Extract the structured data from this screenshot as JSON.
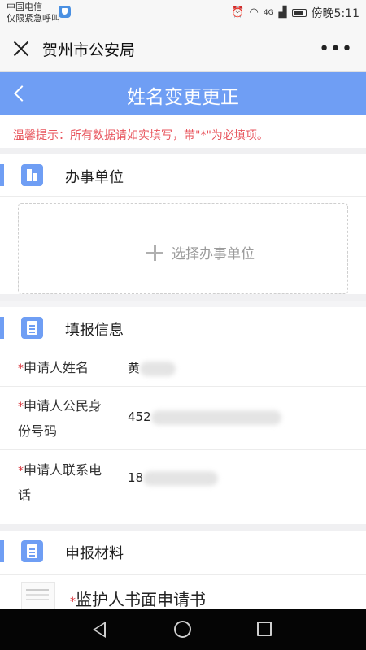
{
  "status_bar": {
    "carrier": "中国电信",
    "emergency": "仅限紧急呼叫",
    "network": "4G",
    "time": "傍晚5:11"
  },
  "app_bar": {
    "title": "贺州市公安局",
    "more": "•••"
  },
  "page": {
    "title": "姓名变更更正"
  },
  "notice": "温馨提示：所有数据请如实填写，带\"*\"为必填项。",
  "sections": {
    "unit": {
      "title": "办事单位",
      "select_label": "选择办事单位"
    },
    "info": {
      "title": "填报信息",
      "fields": [
        {
          "required": "*",
          "label": "申请人姓名",
          "value_visible": "黄"
        },
        {
          "required": "*",
          "label_line1": "申请人公民身",
          "label_line2": "份号码",
          "value_visible": "452"
        },
        {
          "required": "*",
          "label_line1": "申请人联系电",
          "label_line2": "话",
          "value_visible": "18"
        }
      ]
    },
    "materials": {
      "title": "申报材料",
      "items": [
        {
          "required": "*",
          "label": "监护人书面申请书"
        }
      ]
    }
  },
  "colors": {
    "header_blue": "#6f9ef4",
    "notice_red": "#e8565e",
    "required_red": "#d9343b"
  }
}
